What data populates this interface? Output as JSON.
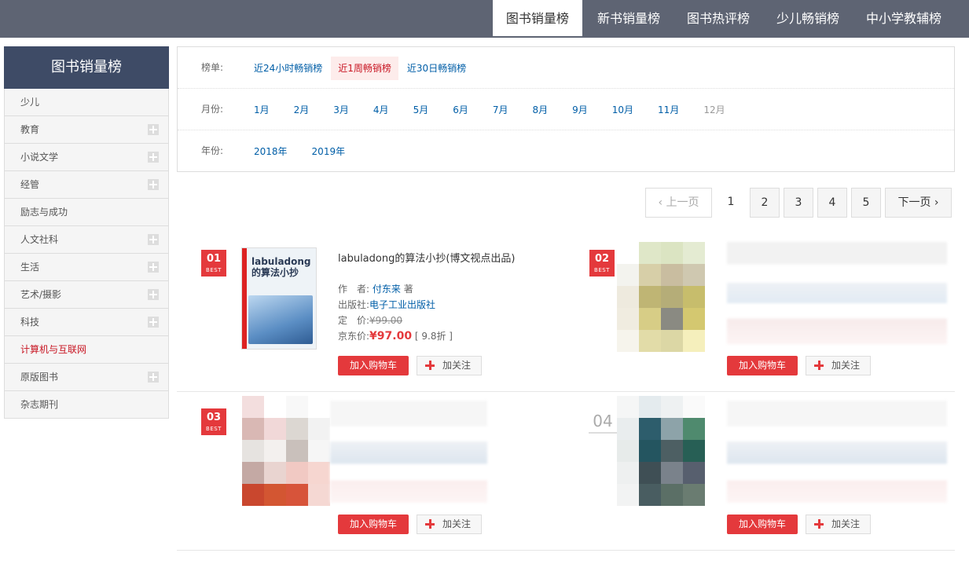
{
  "topnav": {
    "tabs": [
      {
        "label": "图书销量榜",
        "active": true
      },
      {
        "label": "新书销量榜",
        "active": false
      },
      {
        "label": "图书热评榜",
        "active": false
      },
      {
        "label": "少儿畅销榜",
        "active": false
      },
      {
        "label": "中小学教辅榜",
        "active": false
      }
    ]
  },
  "sidebar": {
    "title": "图书销量榜",
    "items": [
      {
        "label": "少儿",
        "expandable": false
      },
      {
        "label": "教育",
        "expandable": true
      },
      {
        "label": "小说文学",
        "expandable": true
      },
      {
        "label": "经管",
        "expandable": true
      },
      {
        "label": "励志与成功",
        "expandable": false
      },
      {
        "label": "人文社科",
        "expandable": true
      },
      {
        "label": "生活",
        "expandable": true
      },
      {
        "label": "艺术/摄影",
        "expandable": true
      },
      {
        "label": "科技",
        "expandable": true
      },
      {
        "label": "计算机与互联网",
        "expandable": false,
        "active": true
      },
      {
        "label": "原版图书",
        "expandable": true
      },
      {
        "label": "杂志期刊",
        "expandable": false
      }
    ]
  },
  "filters": {
    "list_label": "榜单:",
    "list_options": [
      "近24小时畅销榜",
      "近1周畅销榜",
      "近30日畅销榜"
    ],
    "list_selected": "近1周畅销榜",
    "month_label": "月份:",
    "months": [
      "1月",
      "2月",
      "3月",
      "4月",
      "5月",
      "6月",
      "7月",
      "8月",
      "9月",
      "10月",
      "11月",
      "12月"
    ],
    "month_disabled": "12月",
    "year_label": "年份:",
    "years": [
      "2018年",
      "2019年"
    ]
  },
  "pagination": {
    "prev": "‹ 上一页",
    "pages": [
      "1",
      "2",
      "3",
      "4",
      "5"
    ],
    "current": "1",
    "next": "下一页 ›"
  },
  "books": [
    {
      "rank": "01",
      "badge": "BEST",
      "title": "labuladong的算法小抄(博文视点出品)",
      "cover_title": "labuladong的算法小抄",
      "author_label": "作　者:",
      "author": "付东来",
      "author_suffix": "著",
      "publisher_label": "出版社:",
      "publisher": "电子工业出版社",
      "list_price_label": "定　价:",
      "list_price": "¥99.00",
      "jd_price_label": "京东价:",
      "jd_price": "¥97.00",
      "discount": "[ 9.8折 ]",
      "cart_label": "加入购物车",
      "follow_label": "加关注"
    },
    {
      "rank": "02",
      "badge": "BEST",
      "cart_label": "加入购物车",
      "follow_label": "加关注"
    },
    {
      "rank": "03",
      "badge": "BEST",
      "cart_label": "加入购物车",
      "follow_label": "加关注"
    },
    {
      "rank": "04",
      "cart_label": "加入购物车",
      "follow_label": "加关注"
    }
  ],
  "colors": {
    "topbar": "#5e6473",
    "sidebar_head": "#3e4b66",
    "accent_red": "#e4393c",
    "link_blue": "#005ea7"
  }
}
